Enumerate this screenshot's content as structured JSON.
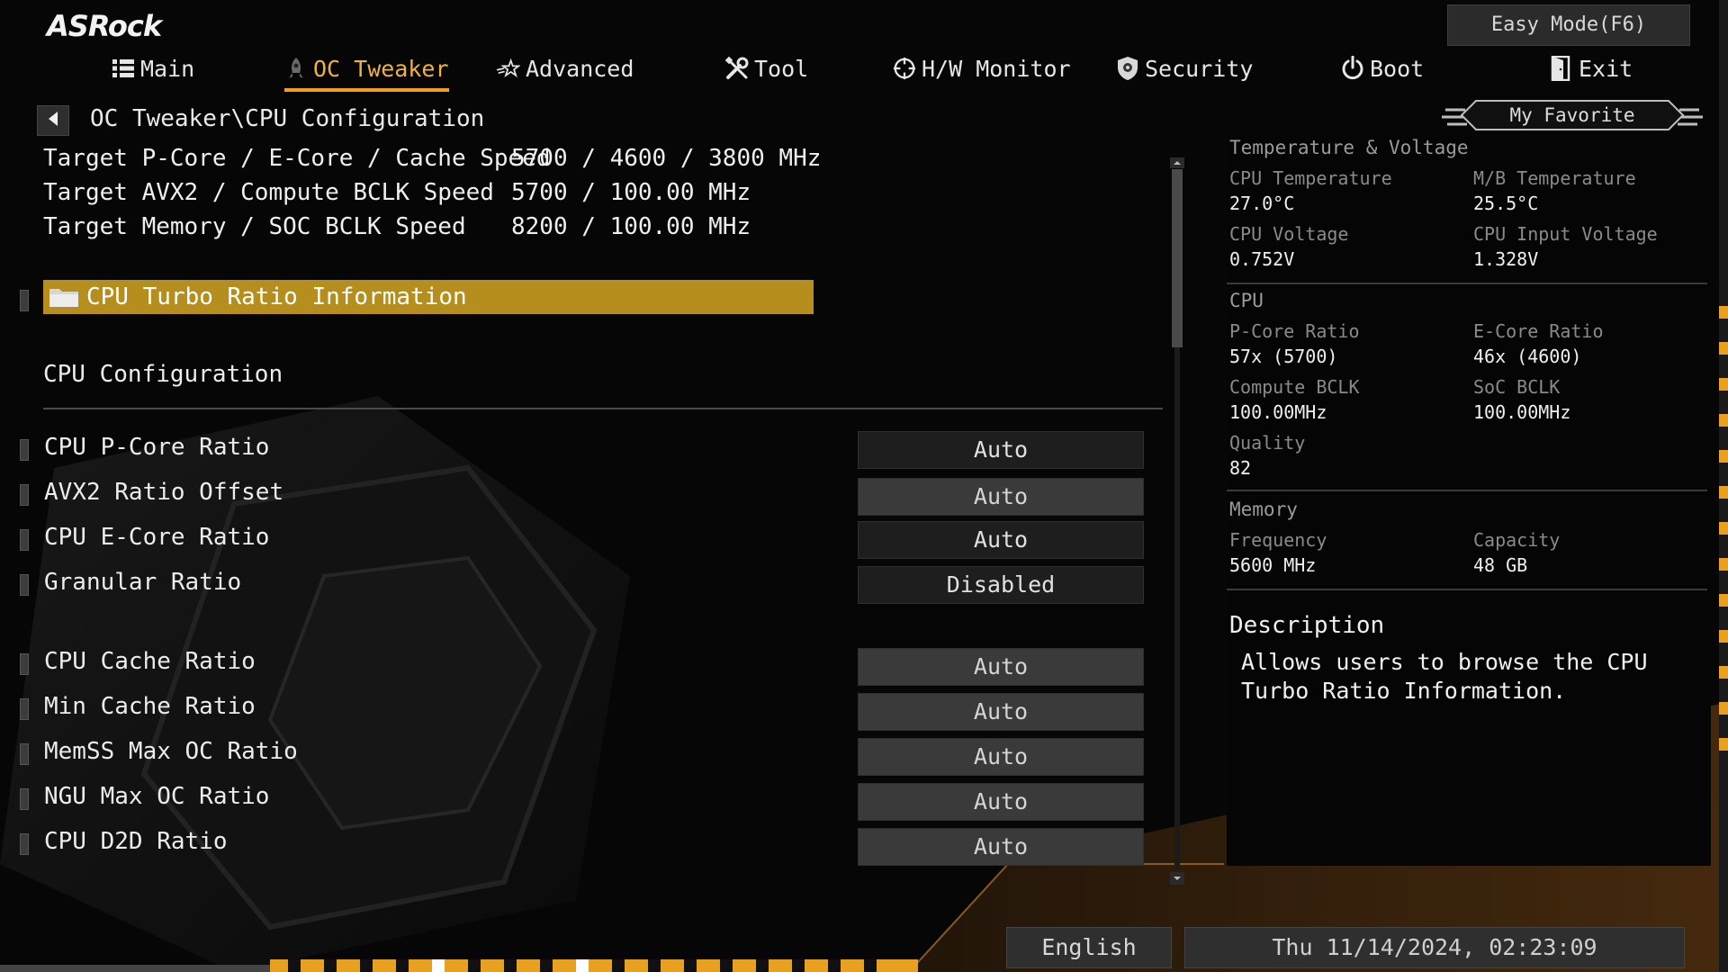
{
  "header": {
    "brand": "ASRock",
    "easy_mode_label": "Easy Mode(F6)"
  },
  "tabs": [
    {
      "label": "Main",
      "icon": "list-icon"
    },
    {
      "label": "OC Tweaker",
      "icon": "rocket-icon",
      "active": true
    },
    {
      "label": "Advanced",
      "icon": "star-icon"
    },
    {
      "label": "Tool",
      "icon": "tools-icon"
    },
    {
      "label": "H/W Monitor",
      "icon": "crosshair-icon"
    },
    {
      "label": "Security",
      "icon": "shield-icon"
    },
    {
      "label": "Boot",
      "icon": "power-icon"
    },
    {
      "label": "Exit",
      "icon": "exit-door-icon"
    }
  ],
  "breadcrumb": "OC Tweaker\\CPU Configuration",
  "favorite_label": "My Favorite",
  "targets": [
    {
      "label": "Target P-Core / E-Core / Cache Speed",
      "value": "5700 / 4600 / 3800 MHz"
    },
    {
      "label": "Target AVX2 / Compute BCLK Speed",
      "value": "5700 / 100.00 MHz"
    },
    {
      "label": "Target Memory / SOC BCLK Speed",
      "value": "8200 / 100.00 MHz"
    }
  ],
  "selected_item": "CPU Turbo Ratio Information",
  "section_title": "CPU Configuration",
  "options": [
    {
      "label": "CPU P-Core Ratio",
      "value": "Auto"
    },
    {
      "label": "AVX2 Ratio Offset",
      "value": "Auto"
    },
    {
      "label": "CPU E-Core Ratio",
      "value": "Auto"
    },
    {
      "label": "Granular Ratio",
      "value": "Disabled"
    },
    {
      "label": "CPU Cache  Ratio",
      "value": "Auto"
    },
    {
      "label": "Min Cache  Ratio",
      "value": "Auto"
    },
    {
      "label": "MemSS Max OC Ratio",
      "value": "Auto"
    },
    {
      "label": "NGU Max OC Ratio",
      "value": "Auto"
    },
    {
      "label": "CPU D2D Ratio",
      "value": "Auto"
    }
  ],
  "monitor": {
    "temp_heading": "Temperature & Voltage",
    "cpu_temp_label": "CPU Temperature",
    "cpu_temp": "27.0°C",
    "mb_temp_label": "M/B Temperature",
    "mb_temp": "25.5°C",
    "cpu_volt_label": "CPU Voltage",
    "cpu_volt": "0.752V",
    "cpu_in_volt_label": "CPU Input Voltage",
    "cpu_in_volt": "1.328V",
    "cpu_heading": "CPU",
    "pcore_ratio_label": "P-Core Ratio",
    "pcore_ratio": "57x (5700)",
    "ecore_ratio_label": "E-Core Ratio",
    "ecore_ratio": "46x (4600)",
    "compute_bclk_label": "Compute BCLK",
    "compute_bclk": "100.00MHz",
    "soc_bclk_label": "SoC BCLK",
    "soc_bclk": "100.00MHz",
    "quality_label": "Quality",
    "quality": "82",
    "memory_heading": "Memory",
    "frequency_label": "Frequency",
    "frequency": "5600 MHz",
    "capacity_label": "Capacity",
    "capacity": "48 GB"
  },
  "description": {
    "title": "Description",
    "text": "Allows users to browse the CPU Turbo Ratio Information."
  },
  "footer": {
    "language": "English",
    "datetime": "Thu 11/14/2024, 02:23:09"
  },
  "colors": {
    "accent": "#f0a020",
    "highlight": "#b58e1e",
    "background": "#060606"
  }
}
